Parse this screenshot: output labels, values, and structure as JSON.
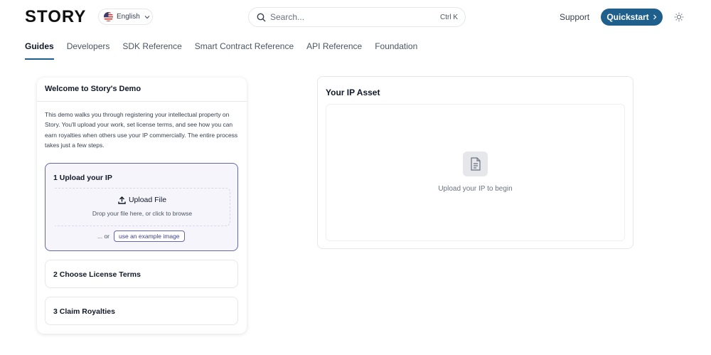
{
  "header": {
    "logo_text": "STORY",
    "language": "English",
    "search_placeholder": "Search...",
    "search_shortcut": "Ctrl K",
    "support_label": "Support",
    "quickstart_label": "Quickstart",
    "accent_color": "#1f5f8b"
  },
  "tabs": [
    {
      "label": "Guides",
      "active": true
    },
    {
      "label": "Developers",
      "active": false
    },
    {
      "label": "SDK Reference",
      "active": false
    },
    {
      "label": "Smart Contract Reference",
      "active": false
    },
    {
      "label": "API Reference",
      "active": false
    },
    {
      "label": "Foundation",
      "active": false
    }
  ],
  "demo": {
    "title": "Welcome to Story's Demo",
    "intro": "This demo walks you through registering your intellectual property on Story. You'll upload your work, set license terms, and see how you can earn royalties when others use your IP commercially. The entire process takes just a few steps.",
    "steps": [
      {
        "label": "1  Upload your IP",
        "upload_label": "Upload File",
        "upload_hint": "Drop your file here, or click to browse",
        "or_text": "... or",
        "example_button": "use an example image"
      },
      {
        "label": "2  Choose License Terms"
      },
      {
        "label": "3  Claim Royalties"
      }
    ]
  },
  "ip_asset": {
    "title": "Your IP Asset",
    "empty_text": "Upload your IP to begin"
  }
}
